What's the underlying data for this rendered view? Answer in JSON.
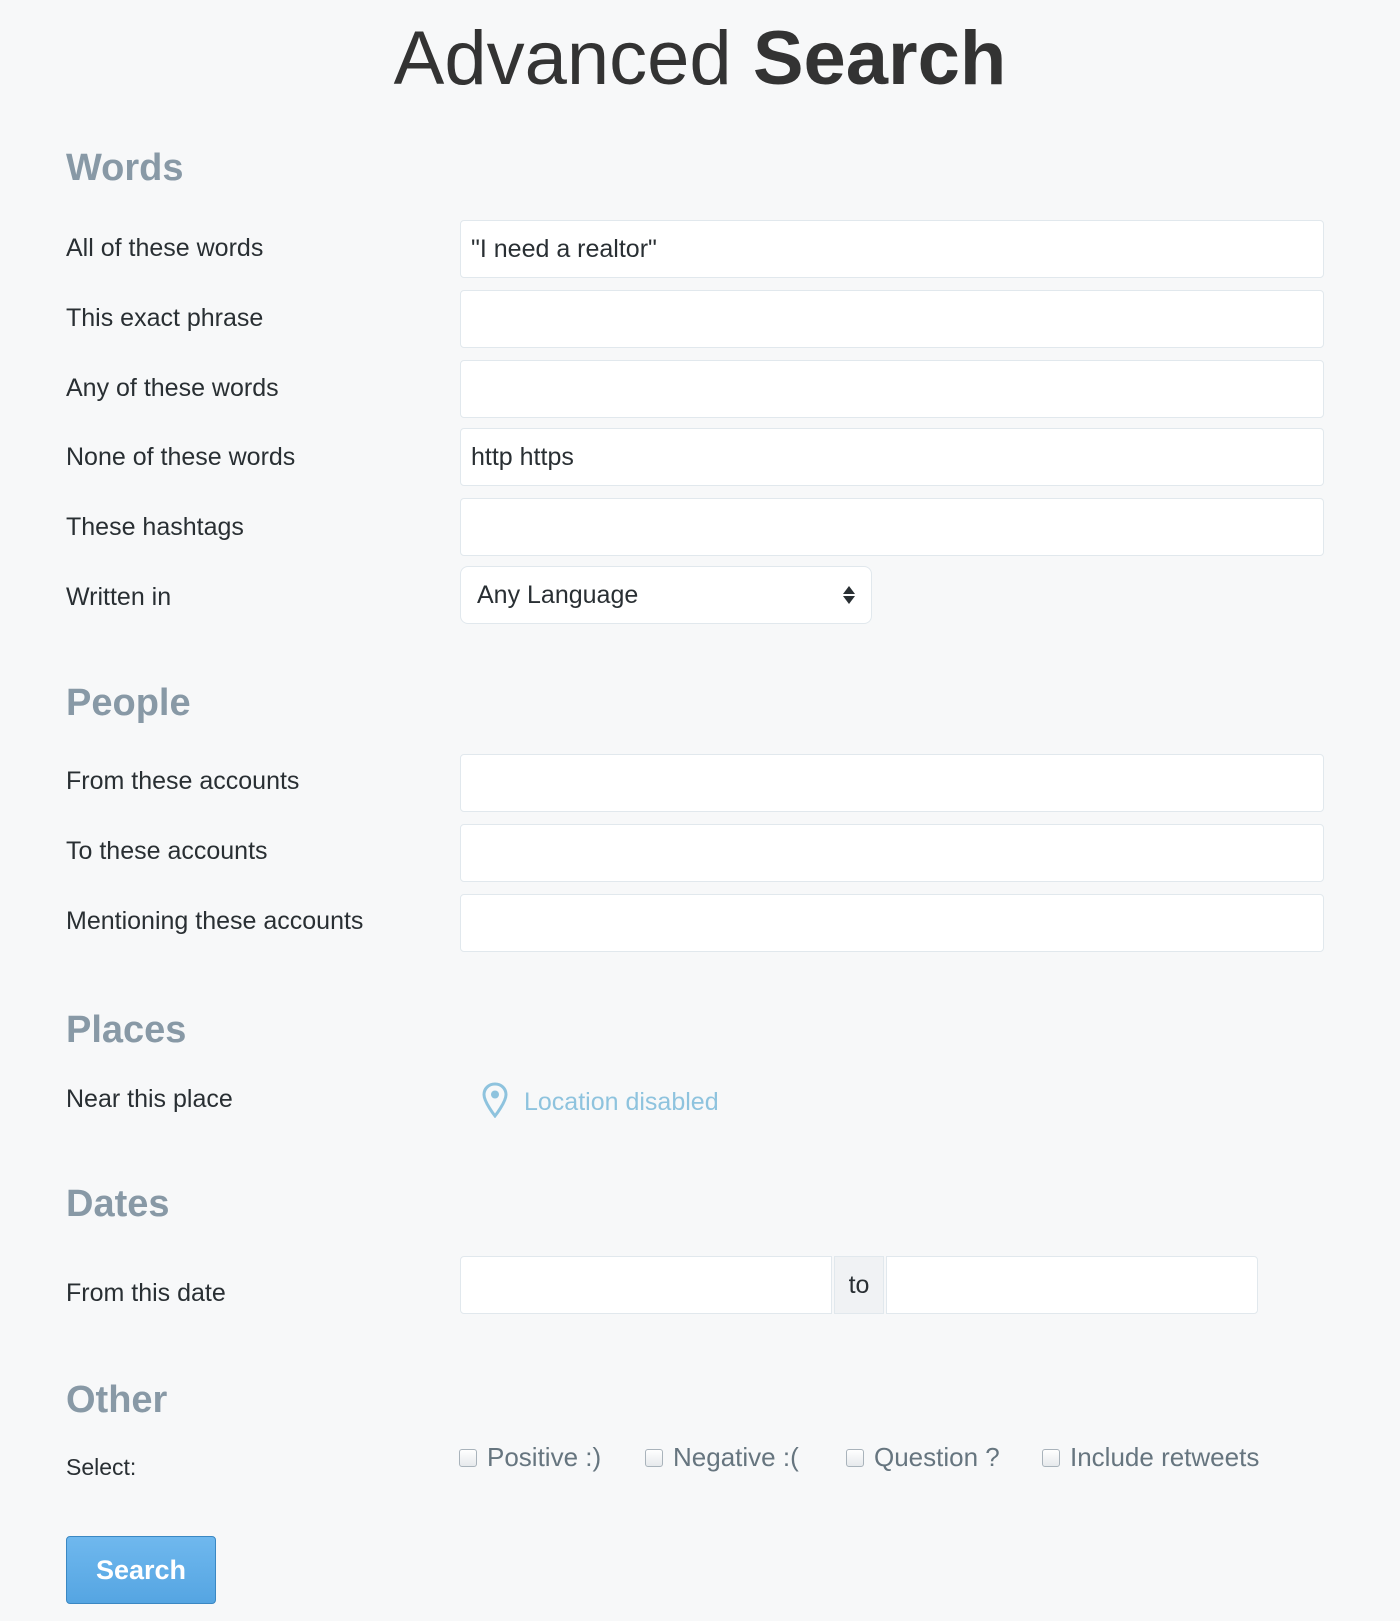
{
  "title": {
    "light": "Advanced",
    "bold": "Search"
  },
  "sections": {
    "words": {
      "heading": "Words",
      "all_words": {
        "label": "All of these words",
        "value": "\"I need a realtor\""
      },
      "exact_phrase": {
        "label": "This exact phrase",
        "value": ""
      },
      "any_words": {
        "label": "Any of these words",
        "value": ""
      },
      "none_words": {
        "label": "None of these words",
        "value": "http https"
      },
      "hashtags": {
        "label": "These hashtags",
        "value": ""
      },
      "language": {
        "label": "Written in",
        "selected": "Any Language"
      }
    },
    "people": {
      "heading": "People",
      "from_accounts": {
        "label": "From these accounts",
        "value": ""
      },
      "to_accounts": {
        "label": "To these accounts",
        "value": ""
      },
      "mentioning_accounts": {
        "label": "Mentioning these accounts",
        "value": ""
      }
    },
    "places": {
      "heading": "Places",
      "near_place": {
        "label": "Near this place",
        "status": "Location disabled",
        "icon": "map-pin-icon"
      }
    },
    "dates": {
      "heading": "Dates",
      "from_date": {
        "label": "From this date",
        "to_label": "to"
      }
    },
    "other": {
      "heading": "Other",
      "select_label": "Select:",
      "options": {
        "positive": "Positive :)",
        "negative": "Negative :(",
        "question": "Question ?",
        "retweets": "Include retweets"
      }
    }
  },
  "search_button": {
    "label": "Search"
  },
  "colors": {
    "background": "#f7f8f9",
    "section_heading": "#8899a6",
    "location_text": "#8ec3de",
    "button": "#55a5e2"
  }
}
